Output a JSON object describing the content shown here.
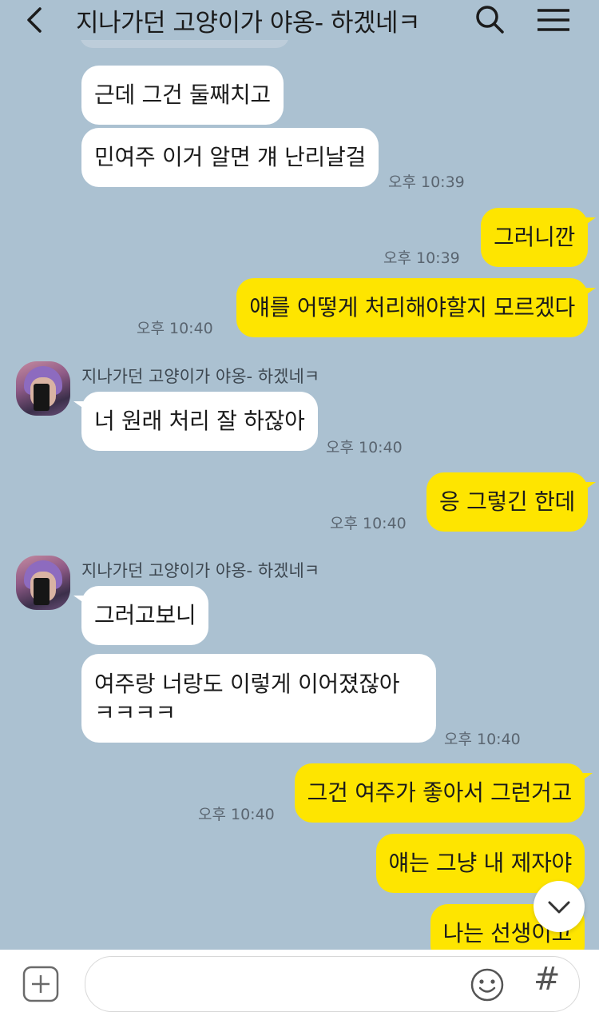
{
  "header": {
    "title": "지나가던 고양이가 야옹- 하겠네ㅋ"
  },
  "colors": {
    "background": "#abc1d1",
    "incoming_bubble": "#ffffff",
    "outgoing_bubble": "#fee500"
  },
  "messages": [
    {
      "direction": "in",
      "text": "근데 그건 둘째치고"
    },
    {
      "direction": "in",
      "text": "민여주 이거 알면 걔 난리날걸",
      "time": "오후 10:39"
    },
    {
      "direction": "out",
      "text": "그러니깐",
      "time": "오후 10:39"
    },
    {
      "direction": "out",
      "text": "얘를 어떻게 처리해야할지 모르겠다",
      "time": "오후 10:40"
    },
    {
      "direction": "in",
      "sender": "지나가던 고양이가 야옹- 하겠네ㅋ",
      "text": "너 원래 처리 잘 하잖아",
      "time": "오후 10:40"
    },
    {
      "direction": "out",
      "text": "응 그렇긴 한데",
      "time": "오후 10:40"
    },
    {
      "direction": "in",
      "sender": "지나가던 고양이가 야옹- 하겠네ㅋ",
      "text": "그러고보니"
    },
    {
      "direction": "in",
      "text_line1": "여주랑 너랑도 이렇게 이어졌잖아",
      "text_line2": "ㅋㅋㅋㅋ",
      "time": "오후 10:40"
    },
    {
      "direction": "out",
      "text": "그건 여주가 좋아서 그런거고",
      "time": "오후 10:40"
    },
    {
      "direction": "out",
      "text": "얘는 그냥 내 제자야"
    },
    {
      "direction": "out",
      "text": "나는 선생이고"
    }
  ],
  "icons": {
    "back": "chevron-left-icon",
    "search": "search-icon",
    "menu": "hamburger-menu-icon",
    "scroll_down": "chevron-down-icon",
    "attach": "plus-square-icon",
    "emoji": "smiley-icon",
    "hashtag": "hash-icon"
  },
  "footer": {
    "input_placeholder": "",
    "hash_label": "#"
  }
}
